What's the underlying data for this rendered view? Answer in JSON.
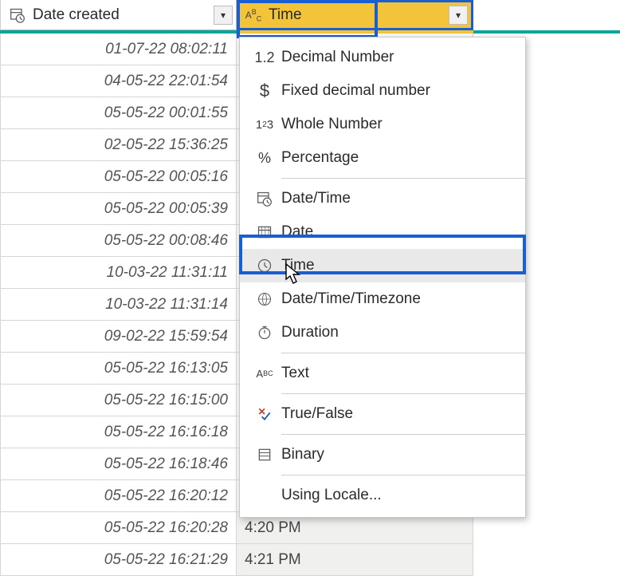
{
  "columns": {
    "date_created": {
      "label": "Date created"
    },
    "time": {
      "label": "Time"
    }
  },
  "rows": [
    {
      "date": "01-07-22 08:02:11",
      "time": ""
    },
    {
      "date": "04-05-22 22:01:54",
      "time": ""
    },
    {
      "date": "05-05-22 00:01:55",
      "time": ""
    },
    {
      "date": "02-05-22 15:36:25",
      "time": ""
    },
    {
      "date": "05-05-22 00:05:16",
      "time": ""
    },
    {
      "date": "05-05-22 00:05:39",
      "time": ""
    },
    {
      "date": "05-05-22 00:08:46",
      "time": ""
    },
    {
      "date": "10-03-22 11:31:11",
      "time": ""
    },
    {
      "date": "10-03-22 11:31:14",
      "time": ""
    },
    {
      "date": "09-02-22 15:59:54",
      "time": ""
    },
    {
      "date": "05-05-22 16:13:05",
      "time": ""
    },
    {
      "date": "05-05-22 16:15:00",
      "time": ""
    },
    {
      "date": "05-05-22 16:16:18",
      "time": ""
    },
    {
      "date": "05-05-22 16:18:46",
      "time": ""
    },
    {
      "date": "05-05-22 16:20:12",
      "time": ""
    },
    {
      "date": "05-05-22 16:20:28",
      "time": "4:20 PM"
    },
    {
      "date": "05-05-22 16:21:29",
      "time": "4:21 PM"
    }
  ],
  "menu": {
    "decimal": {
      "label": "Decimal Number",
      "icon": "1.2"
    },
    "fixed": {
      "label": "Fixed decimal number",
      "icon": "$"
    },
    "whole": {
      "label": "Whole Number",
      "icon": "1²3"
    },
    "percent": {
      "label": "Percentage",
      "icon": "%"
    },
    "datetime": {
      "label": "Date/Time",
      "icon": "datetime-icon"
    },
    "date": {
      "label": "Date",
      "icon": "date-icon"
    },
    "time": {
      "label": "Time",
      "icon": "time-icon"
    },
    "dttz": {
      "label": "Date/Time/Timezone",
      "icon": "globe-icon"
    },
    "duration": {
      "label": "Duration",
      "icon": "duration-icon"
    },
    "text": {
      "label": "Text",
      "icon": "abc-icon"
    },
    "bool": {
      "label": "True/False",
      "icon": "bool-icon"
    },
    "binary": {
      "label": "Binary",
      "icon": "binary-icon"
    },
    "locale": {
      "label": "Using Locale..."
    }
  }
}
